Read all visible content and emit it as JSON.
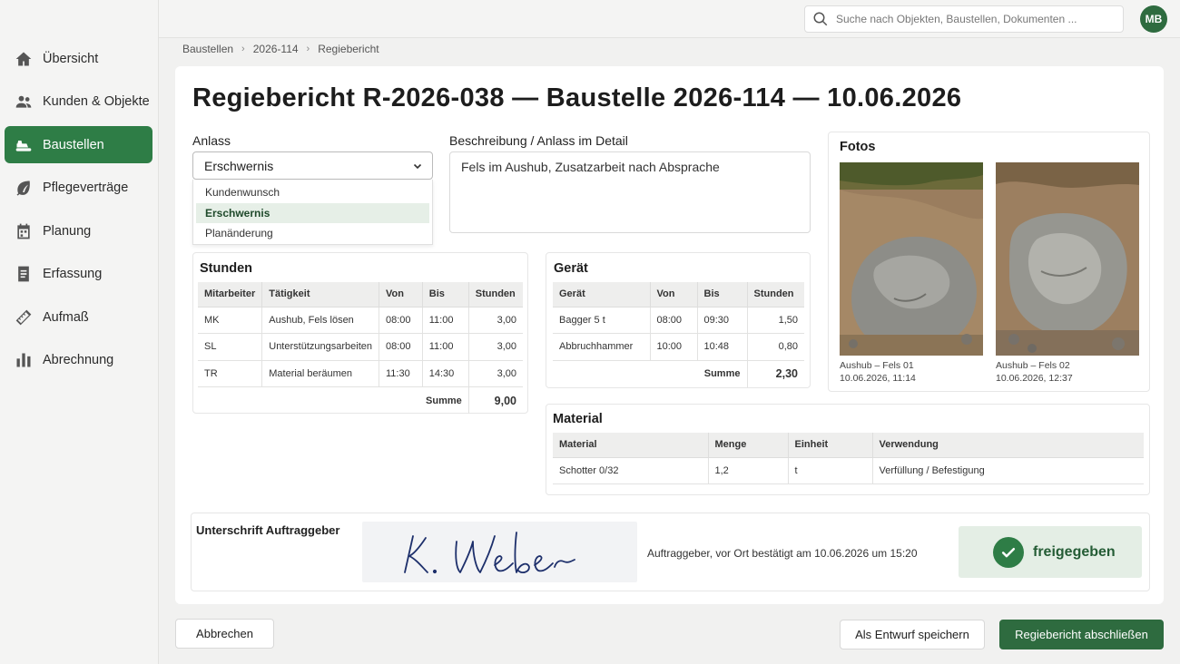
{
  "search": {
    "placeholder": "Suche nach Objekten, Baustellen, Dokumenten ..."
  },
  "user": {
    "initials": "MB"
  },
  "sidebar": {
    "items": [
      {
        "label": "Übersicht",
        "icon": "home-icon"
      },
      {
        "label": "Kunden & Objekte",
        "icon": "people-icon"
      },
      {
        "label": "Baustellen",
        "icon": "excavator-icon",
        "active": true
      },
      {
        "label": "Pflegeverträge",
        "icon": "leaf-icon"
      },
      {
        "label": "Planung",
        "icon": "calendar-icon"
      },
      {
        "label": "Erfassung",
        "icon": "document-icon"
      },
      {
        "label": "Aufmaß",
        "icon": "ruler-icon"
      },
      {
        "label": "Abrechnung",
        "icon": "bar-chart-icon"
      }
    ]
  },
  "breadcrumb": [
    "Baustellen",
    "2026-114",
    "Regiebericht"
  ],
  "title": "Regiebericht R-2026-038 — Baustelle 2026-114 — 10.06.2026",
  "anlass": {
    "label": "Anlass",
    "value": "Erschwernis",
    "options": [
      "Kundenwunsch",
      "Erschwernis",
      "Planänderung"
    ]
  },
  "beschreibung": {
    "label": "Beschreibung / Anlass im Detail",
    "value": "Fels im Aushub, Zusatzarbeit nach Absprache"
  },
  "stunden": {
    "title": "Stunden",
    "headers": [
      "Mitarbeiter",
      "Tätigkeit",
      "Von",
      "Bis",
      "Stunden"
    ],
    "rows": [
      [
        "MK",
        "Aushub, Fels lösen",
        "08:00",
        "11:00",
        "3,00"
      ],
      [
        "SL",
        "Unterstützungsarbeiten",
        "08:00",
        "11:00",
        "3,00"
      ],
      [
        "TR",
        "Material beräumen",
        "11:30",
        "14:30",
        "3,00"
      ]
    ],
    "sum_label": "Summe",
    "sum_value": "9,00"
  },
  "geraet": {
    "title": "Gerät",
    "headers": [
      "Gerät",
      "Von",
      "Bis",
      "Stunden"
    ],
    "rows": [
      [
        "Bagger 5 t",
        "08:00",
        "09:30",
        "1,50"
      ],
      [
        "Abbruchhammer",
        "10:00",
        "10:48",
        "0,80"
      ]
    ],
    "sum_label": "Summe",
    "sum_value": "2,30"
  },
  "material": {
    "title": "Material",
    "headers": [
      "Material",
      "Menge",
      "Einheit",
      "Verwendung"
    ],
    "rows": [
      [
        "Schotter 0/32",
        "1,2",
        "t",
        "Verfüllung / Befestigung"
      ]
    ]
  },
  "fotos": {
    "title": "Fotos",
    "items": [
      {
        "caption": "Aushub – Fels 01",
        "time": "10.06.2026, 11:14"
      },
      {
        "caption": "Aushub – Fels 02",
        "time": "10.06.2026, 12:37"
      }
    ]
  },
  "signature": {
    "label": "Unterschrift Auftraggeber",
    "confirmation": "Auftraggeber, vor Ort bestätigt am 10.06.2026 um 15:20",
    "status": "freigegeben"
  },
  "actions": {
    "cancel": "Abbrechen",
    "draft": "Als Entwurf speichern",
    "finish": "Regiebericht abschließen"
  },
  "colors": {
    "accent": "#2e7d46",
    "primary_button": "#2e6b3f"
  }
}
